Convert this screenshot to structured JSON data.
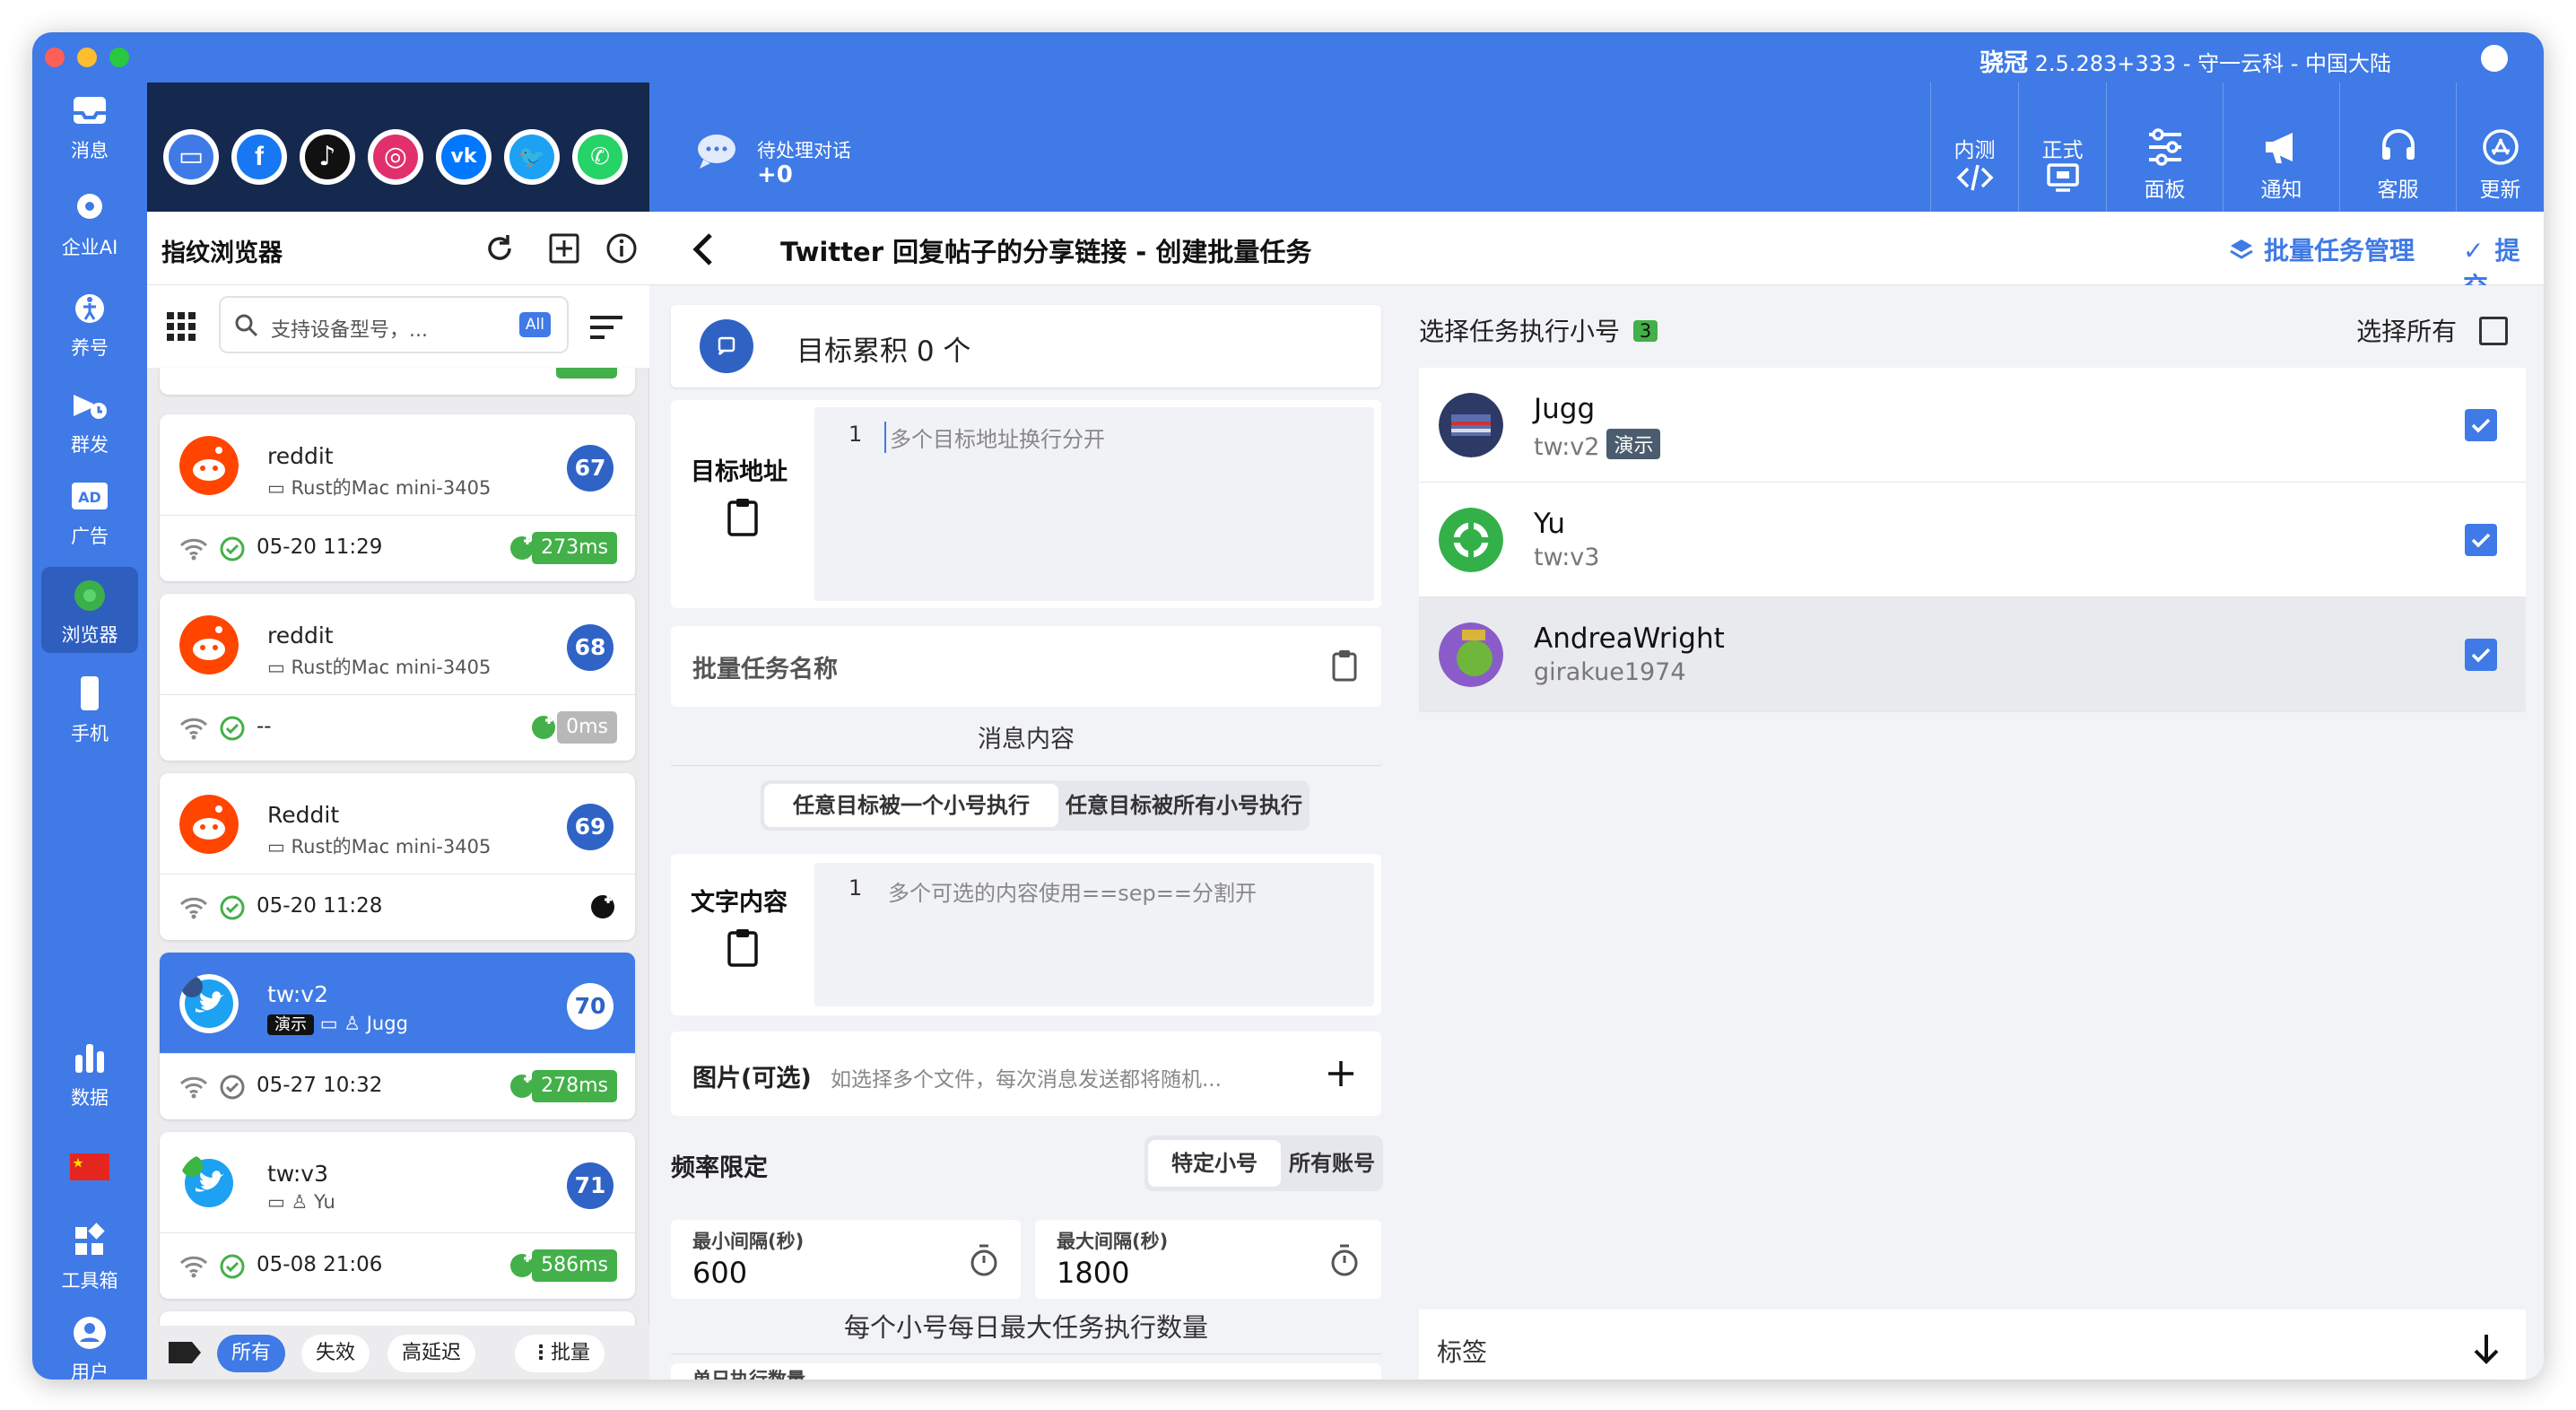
{
  "window": {
    "app_name": "骁冠",
    "title_rest": "2.5.283+333 - 守一云科 - 中国大陆"
  },
  "nav": {
    "items": [
      {
        "label": "消息",
        "icon": "inbox-icon"
      },
      {
        "label": "企业AI",
        "icon": "gear-ai-icon"
      },
      {
        "label": "养号",
        "icon": "person-walk-icon"
      },
      {
        "label": "群发",
        "icon": "megaphone-icon"
      },
      {
        "label": "广告",
        "icon": "ad-icon"
      },
      {
        "label": "浏览器",
        "icon": "chrome-icon"
      },
      {
        "label": "手机",
        "icon": "phone-icon"
      },
      {
        "label": "数据",
        "icon": "bar-chart-icon"
      },
      {
        "label": "工具箱",
        "icon": "widgets-icon"
      },
      {
        "label": "用户",
        "icon": "user-icon"
      }
    ]
  },
  "social": [
    "pc-icon",
    "facebook-icon",
    "tiktok-icon",
    "instagram-icon",
    "vk-icon",
    "twitter-icon",
    "whatsapp-icon"
  ],
  "topbar": {
    "pending_label": "待处理对话",
    "pending_value": "+0",
    "env_test": "内测",
    "env_prod": "正式",
    "buttons": [
      {
        "label": "面板",
        "icon": "sliders-icon"
      },
      {
        "label": "通知",
        "icon": "bullhorn-icon"
      },
      {
        "label": "客服",
        "icon": "headset-icon"
      },
      {
        "label": "更新",
        "icon": "app-store-icon"
      }
    ]
  },
  "left_panel": {
    "title": "指纹浏览器",
    "search_placeholder": "支持设备型号，...",
    "search_badge": "All",
    "cards": [
      {
        "name": "reddit",
        "device": "Rust的Mac mini-3405",
        "num": "67",
        "time": "05-20 11:29",
        "ms": "273ms"
      },
      {
        "name": "reddit",
        "device": "Rust的Mac mini-3405",
        "num": "68",
        "time": "--",
        "ms": "0ms"
      },
      {
        "name": "Reddit",
        "device": "Rust的Mac mini-3405",
        "num": "69",
        "time": "05-20 11:28",
        "ms": ""
      },
      {
        "name": "tw:v2",
        "tag": "演示",
        "user": "Jugg",
        "num": "70",
        "time": "05-27 10:32",
        "ms": "278ms"
      },
      {
        "name": "tw:v3",
        "user": "Yu",
        "num": "71",
        "time": "05-08 21:06",
        "ms": "586ms"
      }
    ],
    "partial_name": "girakue1974",
    "filters": {
      "all": "所有",
      "invalid": "失效",
      "high_latency": "高延迟",
      "batch": "批量"
    }
  },
  "main": {
    "page_title": "Twitter 回复帖子的分享链接 - 创建批量任务",
    "batch_manage": "批量任务管理",
    "submit": "提交",
    "target_total": "目标累积 0 个",
    "target_addr_label": "目标地址",
    "target_line_no": "1",
    "target_placeholder": "多个目标地址换行分开",
    "batch_name_label": "批量任务名称",
    "message_content": "消息内容",
    "mode_one": "任意目标被一个小号执行",
    "mode_all": "任意目标被所有小号执行",
    "text_content_label": "文字内容",
    "text_line_no": "1",
    "text_placeholder": "多个可选的内容使用==sep==分割开",
    "image_label": "图片(可选)",
    "image_hint": "如选择多个文件，每次消息发送都将随机...",
    "rate_limit": "频率限定",
    "rate_specific": "特定小号",
    "rate_all": "所有账号",
    "min_interval_label": "最小间隔(秒)",
    "min_interval_value": "600",
    "max_interval_label": "最大间隔(秒)",
    "max_interval_value": "1800",
    "daily_max": "每个小号每日最大任务执行数量",
    "single_exec": "单日执行数量"
  },
  "right": {
    "select_title": "选择任务执行小号",
    "select_count": "3",
    "select_all": "选择所有",
    "accounts": [
      {
        "name": "Jugg",
        "sub": "tw:v2",
        "tag": "演示"
      },
      {
        "name": "Yu",
        "sub": "tw:v3"
      },
      {
        "name": "AndreaWright",
        "sub": "girakue1974"
      }
    ],
    "tags_label": "标签"
  }
}
